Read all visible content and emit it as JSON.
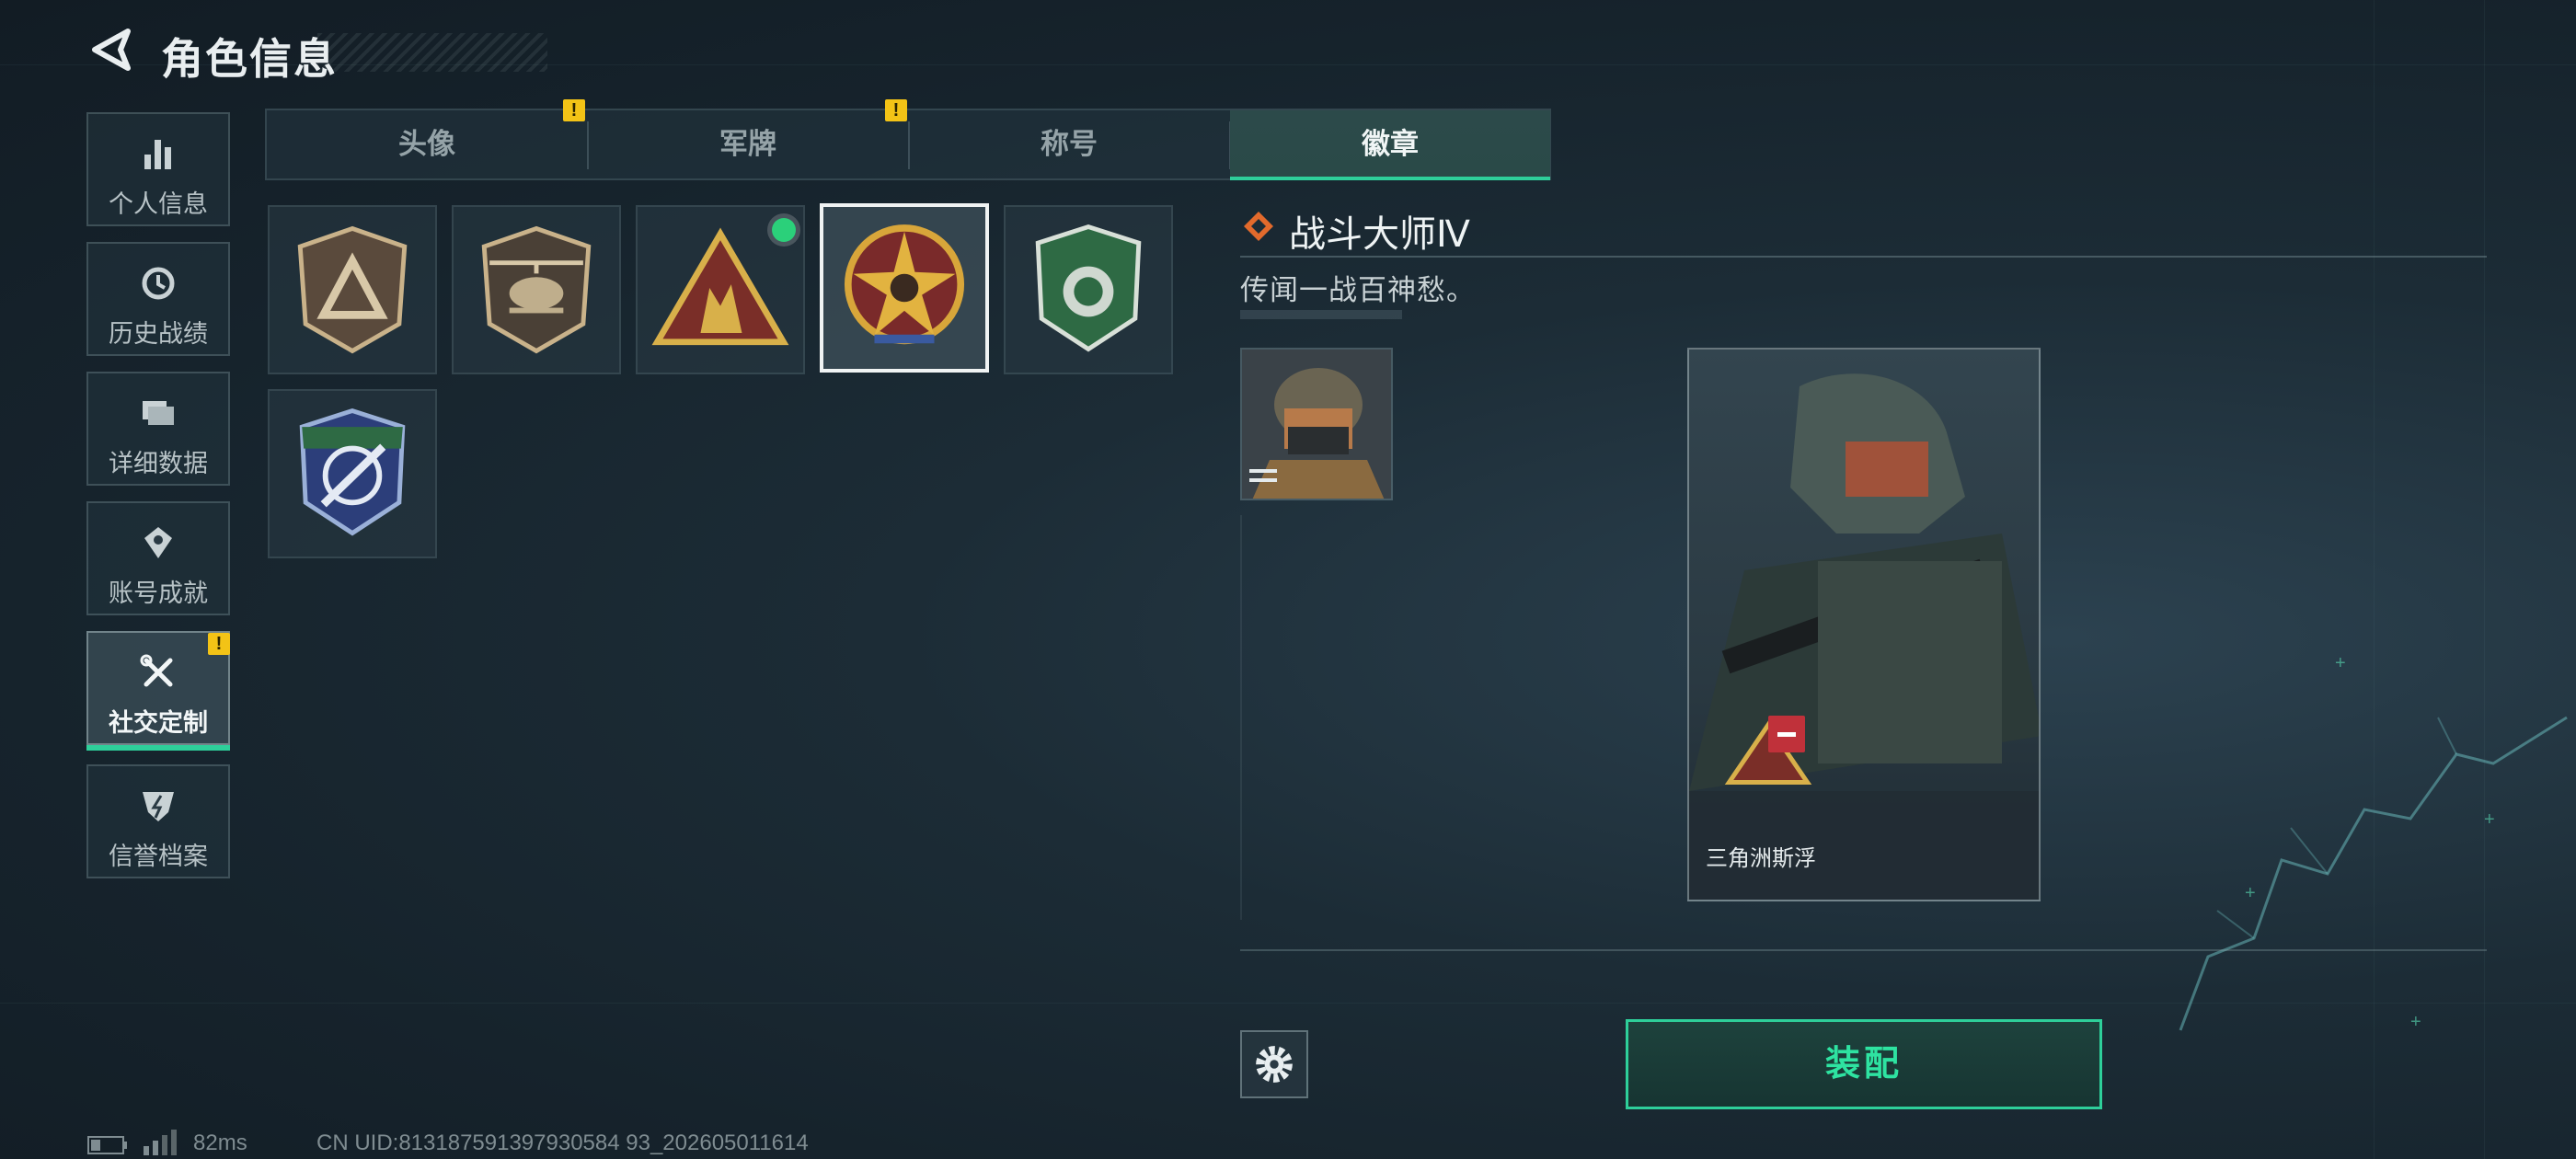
{
  "header": {
    "title": "角色信息"
  },
  "sidebar": {
    "items": [
      {
        "label": "个人信息",
        "icon": "bar-chart-icon",
        "active": false,
        "alert": false
      },
      {
        "label": "历史战绩",
        "icon": "history-icon",
        "active": false,
        "alert": false
      },
      {
        "label": "详细数据",
        "icon": "folder-icon",
        "active": false,
        "alert": false
      },
      {
        "label": "账号成就",
        "icon": "achievement-icon",
        "active": false,
        "alert": false
      },
      {
        "label": "社交定制",
        "icon": "tools-icon",
        "active": true,
        "alert": true
      },
      {
        "label": "信誉档案",
        "icon": "credit-icon",
        "active": false,
        "alert": false
      }
    ],
    "alert_symbol": "!"
  },
  "tabs": [
    {
      "label": "头像",
      "alert": true,
      "active": false
    },
    {
      "label": "军牌",
      "alert": true,
      "active": false
    },
    {
      "label": "称号",
      "alert": false,
      "active": false
    },
    {
      "label": "徽章",
      "alert": false,
      "active": true
    }
  ],
  "badges": [
    {
      "name": "triangle-shield-badge",
      "selected": false,
      "equipped": false
    },
    {
      "name": "helicopter-badge",
      "selected": false,
      "equipped": false
    },
    {
      "name": "squad-triangle-badge",
      "selected": false,
      "equipped": true
    },
    {
      "name": "combat-master-star-badge",
      "selected": true,
      "equipped": false
    },
    {
      "name": "green-shield-badge",
      "selected": false,
      "equipped": false
    },
    {
      "name": "blue-sniper-badge",
      "selected": false,
      "equipped": false
    }
  ],
  "detail": {
    "title": "战斗大师Ⅳ",
    "description": "传闻一战百神愁。"
  },
  "preview": {
    "player_name": "三角洲斯浮"
  },
  "actions": {
    "equip_label": "装配",
    "settings_icon": "gear-icon"
  },
  "status": {
    "latency": "82ms",
    "uid": "CN UID:813187591397930584 93_202605011614"
  },
  "colors": {
    "accent": "#2ecf9a",
    "warning": "#f3c316",
    "remove": "#c0313a",
    "equipped_dot": "#2bd07a"
  }
}
